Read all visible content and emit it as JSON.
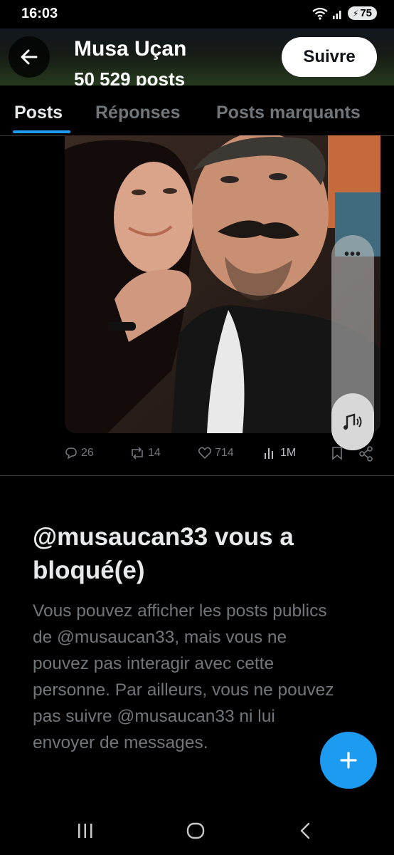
{
  "status_bar": {
    "time": "16:03",
    "battery": "75"
  },
  "header": {
    "name": "Musa Uçan",
    "post_count": "50 529 posts",
    "follow_label": "Suivre"
  },
  "tabs": [
    {
      "label": "Posts",
      "active": true
    },
    {
      "label": "Réponses",
      "active": false
    },
    {
      "label": "Posts marquants",
      "active": false
    }
  ],
  "post": {
    "replies": "26",
    "reposts": "14",
    "likes": "714",
    "views": "1M"
  },
  "blocked": {
    "title": "@musaucan33 vous a bloqué(e)",
    "body": "Vous pouvez afficher les posts publics de @musaucan33, mais vous ne pouvez pas interagir avec cette personne. Par ailleurs, vous ne pouvez pas suivre @musaucan33 ni lui envoyer de messages."
  },
  "colors": {
    "accent": "#1d9bf0",
    "muted": "#71767b",
    "text": "#e7e9ea",
    "background": "#000000"
  },
  "icons": {
    "header": [
      "back-arrow-icon"
    ],
    "actions": [
      "reply-icon",
      "repost-icon",
      "like-icon",
      "views-icon",
      "bookmark-icon",
      "share-icon"
    ],
    "media": [
      "more-icon",
      "sound-icon"
    ],
    "fab": "plus-icon",
    "nav": [
      "recent-apps-icon",
      "home-icon",
      "back-icon"
    ]
  }
}
